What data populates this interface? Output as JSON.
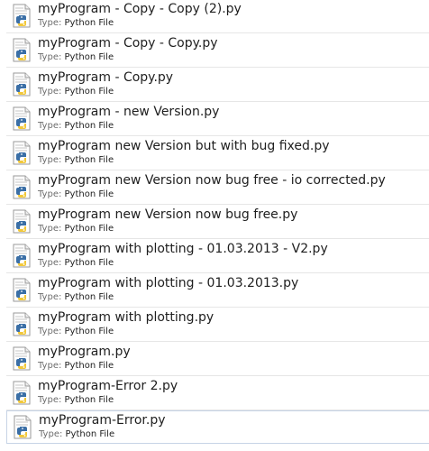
{
  "type_label": "Type:",
  "files": [
    {
      "name": "myProgram - Copy - Copy (2).py",
      "type": "Python File"
    },
    {
      "name": "myProgram - Copy - Copy.py",
      "type": "Python File"
    },
    {
      "name": "myProgram - Copy.py",
      "type": "Python File"
    },
    {
      "name": "myProgram - new Version.py",
      "type": "Python File"
    },
    {
      "name": "myProgram new Version but with bug fixed.py",
      "type": "Python File"
    },
    {
      "name": "myProgram new Version now bug free - io corrected.py",
      "type": "Python File"
    },
    {
      "name": "myProgram new Version now bug free.py",
      "type": "Python File"
    },
    {
      "name": "myProgram with plotting - 01.03.2013 - V2.py",
      "type": "Python File"
    },
    {
      "name": "myProgram with plotting - 01.03.2013.py",
      "type": "Python File"
    },
    {
      "name": "myProgram with plotting.py",
      "type": "Python File"
    },
    {
      "name": "myProgram.py",
      "type": "Python File"
    },
    {
      "name": "myProgram-Error 2.py",
      "type": "Python File"
    },
    {
      "name": "myProgram-Error.py",
      "type": "Python File"
    }
  ],
  "focused_index": 12,
  "icon": "python-file-icon",
  "colors": {
    "python_blue": "#3b6fa6",
    "python_yellow": "#f2c83a",
    "focus_border": "#c7d4e6",
    "row_divider": "#e6e6e6"
  }
}
